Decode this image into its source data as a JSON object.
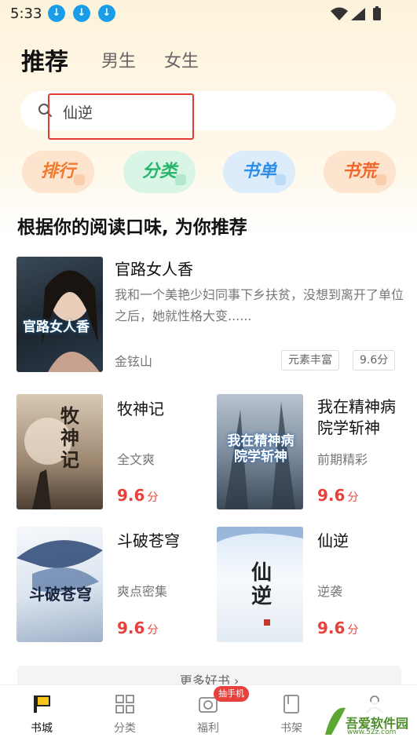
{
  "status": {
    "time": "5:33"
  },
  "header": {
    "tabs": [
      {
        "label": "推荐",
        "active": true
      },
      {
        "label": "男生",
        "active": false
      },
      {
        "label": "女生",
        "active": false
      }
    ]
  },
  "search": {
    "value": "仙逆"
  },
  "pills": [
    {
      "label": "排行",
      "bg": "#fde4cf",
      "color": "#f07a2a"
    },
    {
      "label": "分类",
      "bg": "#d9f5e6",
      "color": "#28b46a"
    },
    {
      "label": "书单",
      "bg": "#dcecfb",
      "color": "#2f8ee6"
    },
    {
      "label": "书荒",
      "bg": "#fde4cf",
      "color": "#f0682a"
    }
  ],
  "section": {
    "title": "根据你的阅读口味, 为你推荐"
  },
  "featured": {
    "title": "官路女人香",
    "cover_text": "官路女人香",
    "description": "我和一个美艳少妇同事下乡扶贫，没想到离开了单位之后，她就性格大变......",
    "author": "金铉山",
    "tags": [
      "元素丰富",
      "9.6分"
    ]
  },
  "books": [
    {
      "title": "牧神记",
      "subtitle": "全文爽",
      "score": "9.6",
      "unit": "分",
      "cover_text": "牧神记"
    },
    {
      "title": "我在精神病院学斩神",
      "subtitle": "前期精彩",
      "score": "9.6",
      "unit": "分",
      "cover_text": "我在精神病院学斩神"
    },
    {
      "title": "斗破苍穹",
      "subtitle": "爽点密集",
      "score": "9.6",
      "unit": "分",
      "cover_text": "斗破苍穹"
    },
    {
      "title": "仙逆",
      "subtitle": "逆袭",
      "score": "9.6",
      "unit": "分",
      "cover_text": "仙逆"
    }
  ],
  "more": {
    "label": "更多好书 ›"
  },
  "nav": {
    "items": [
      {
        "label": "书城",
        "icon": "bookstore-icon",
        "active": true
      },
      {
        "label": "分类",
        "icon": "grid-icon",
        "active": false
      },
      {
        "label": "福利",
        "icon": "camera-icon",
        "active": false
      },
      {
        "label": "书架",
        "icon": "bookshelf-icon",
        "active": false
      },
      {
        "label": "我的",
        "icon": "user-icon",
        "active": false
      }
    ],
    "badge": "抽手机"
  },
  "watermark": {
    "text": "吾爱软件园",
    "url_text": "www.52z.com"
  }
}
